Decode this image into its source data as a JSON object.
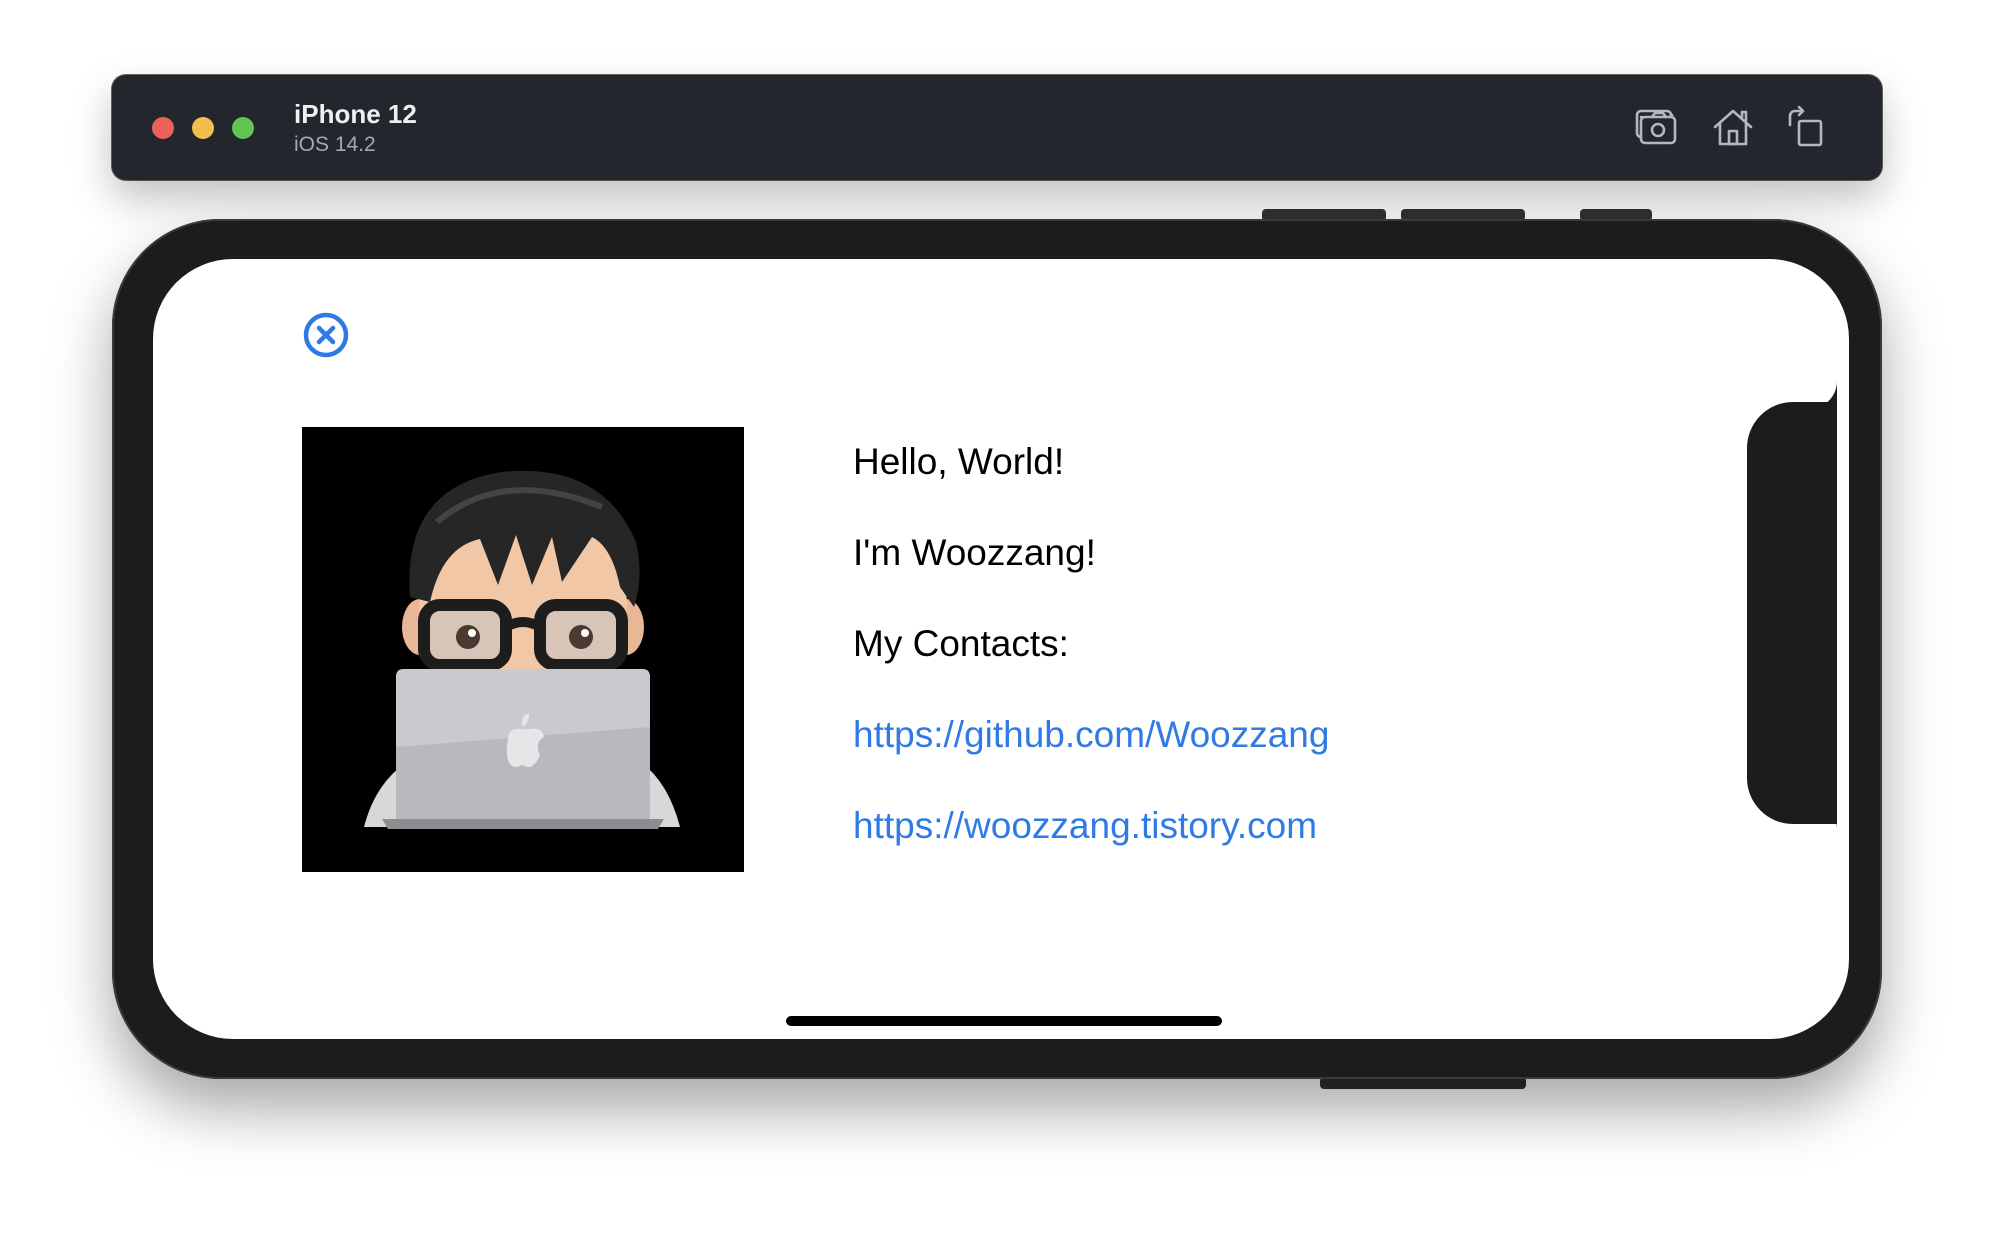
{
  "simulator": {
    "device_name": "iPhone 12",
    "os_version": "iOS 14.2",
    "toolbar_icons": [
      "screenshot-icon",
      "home-icon",
      "rotate-icon"
    ]
  },
  "app": {
    "close_icon": "xmark-circle-icon",
    "avatar_icon": "memoji-avatar-with-laptop",
    "lines": {
      "greeting": "Hello, World!",
      "intro": "I'm Woozzang!",
      "contacts_label": "My Contacts:",
      "github_link": "https://github.com/Woozzang",
      "blog_link": "https://woozzang.tistory.com"
    }
  },
  "colors": {
    "accent": "#2f7ae5",
    "window_bar": "#24262d",
    "device_frame": "#1c1c1e",
    "traffic_close": "#ee5f57",
    "traffic_minimize": "#f4bd4f",
    "traffic_maximize": "#61c554"
  }
}
